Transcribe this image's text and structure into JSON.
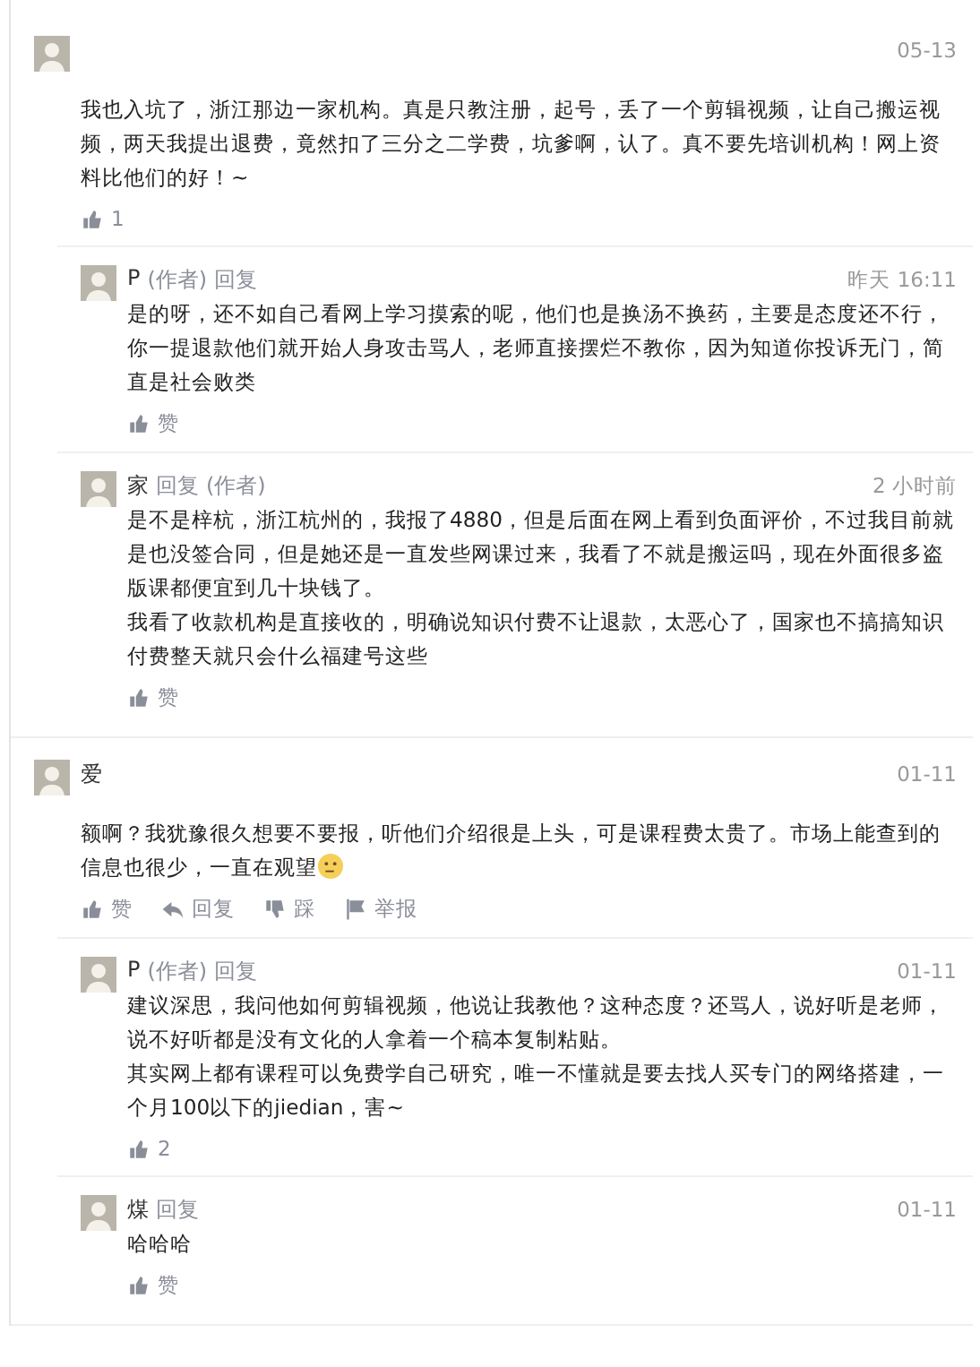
{
  "comments": [
    {
      "time": "05-13",
      "paragraphs": [
        "我也入坑了，浙江那边一家机构。真是只教注册，起号，丢了一个剪辑视频，让自己搬运视频，两天我提出退费，竟然扣了三分之二学费，坑爹啊，认了。真不要先培训机构！网上资料比他们的好！~"
      ],
      "actions": [
        {
          "kind": "like",
          "label": "1"
        }
      ],
      "replies": [
        {
          "author": "P",
          "author_badge": "(作者)",
          "reply_label": "回复",
          "time": "昨天 16:11",
          "paragraphs": [
            "是的呀，还不如自己看网上学习摸索的呢，他们也是换汤不换药，主要是态度还不行，你一提退款他们就开始人身攻击骂人，老师直接摆烂不教你，因为知道你投诉无门，简直是社会败类"
          ],
          "actions": [
            {
              "kind": "like",
              "label": "赞"
            }
          ]
        },
        {
          "author": "家",
          "reply_label": "回复",
          "target_badge": "(作者)",
          "time": "2 小时前",
          "paragraphs": [
            "是不是梓杭，浙江杭州的，我报了4880，但是后面在网上看到负面评价，不过我目前就是也没签合同，但是她还是一直发些网课过来，我看了不就是搬运吗，现在外面很多盗版课都便宜到几十块钱了。",
            "我看了收款机构是直接收的，明确说知识付费不让退款，太恶心了，国家也不搞搞知识付费整天就只会什么福建号这些"
          ],
          "actions": [
            {
              "kind": "like",
              "label": "赞"
            }
          ]
        }
      ]
    },
    {
      "author": "爱",
      "time": "01-11",
      "paragraphs": [
        "额啊？我犹豫很久想要不要报，听他们介绍很是上头，可是课程费太贵了。市场上能查到的信息也很少，一直在观望"
      ],
      "emoji": true,
      "actions": [
        {
          "kind": "like",
          "label": "赞"
        },
        {
          "kind": "reply",
          "label": "回复"
        },
        {
          "kind": "dislike",
          "label": "踩"
        },
        {
          "kind": "report",
          "label": "举报"
        }
      ],
      "replies": [
        {
          "author": "P",
          "author_badge": "(作者)",
          "reply_label": "回复",
          "time": "01-11",
          "paragraphs": [
            "建议深思，我问他如何剪辑视频，他说让我教他？这种态度？还骂人，说好听是老师，说不好听都是没有文化的人拿着一个稿本复制粘贴。",
            "其实网上都有课程可以免费学自己研究，唯一不懂就是要去找人买专门的网络搭建，一个月100以下的jiedian，害~"
          ],
          "actions": [
            {
              "kind": "like",
              "label": "2"
            }
          ]
        },
        {
          "author": "煤",
          "reply_label": "回复",
          "time": "01-11",
          "paragraphs": [
            "哈哈哈"
          ],
          "actions": [
            {
              "kind": "like",
              "label": "赞"
            }
          ]
        }
      ]
    }
  ]
}
